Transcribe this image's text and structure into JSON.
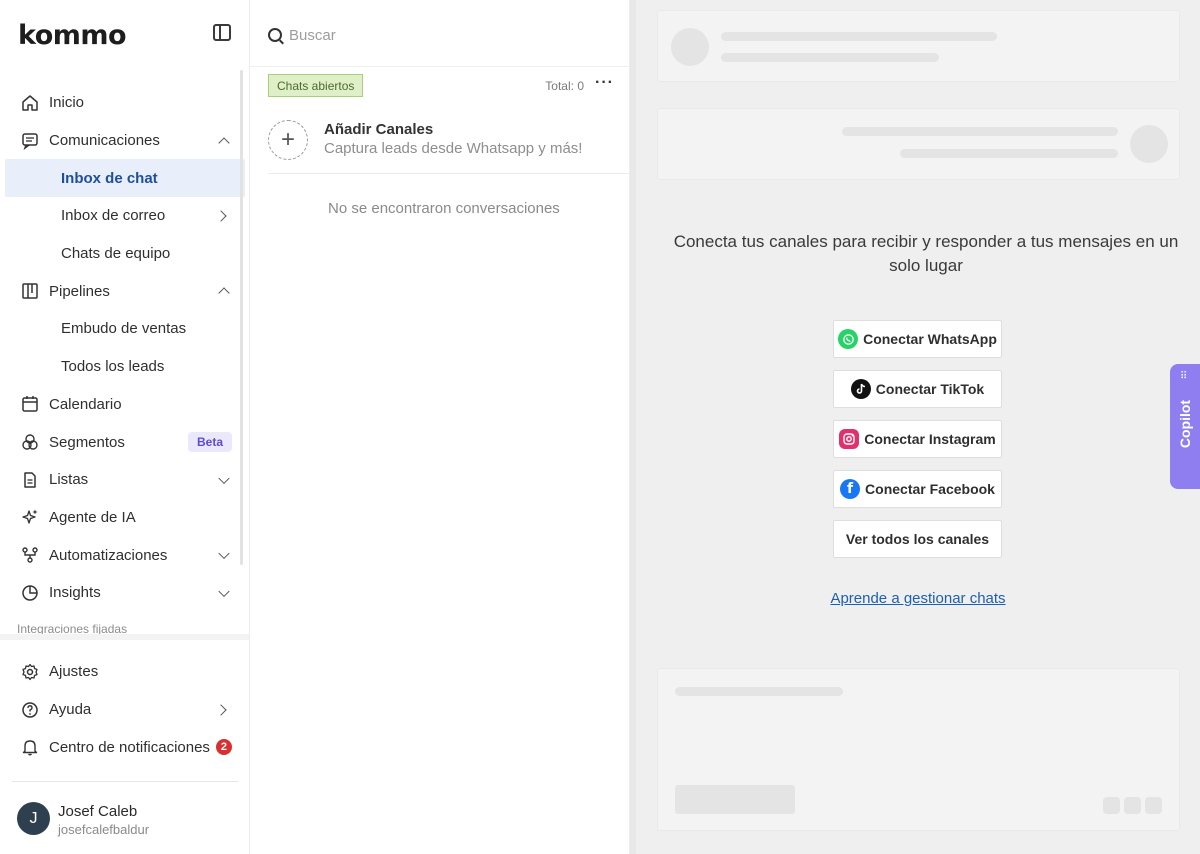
{
  "brand": {
    "logo_text": "kommo"
  },
  "sidebar": {
    "items": [
      {
        "label": "Inicio",
        "icon": "home-icon"
      },
      {
        "label": "Comunicaciones",
        "icon": "chat-bubble-icon",
        "expanded": true
      },
      {
        "label": "Inbox de chat",
        "sub": true,
        "active": true
      },
      {
        "label": "Inbox de correo",
        "sub": true
      },
      {
        "label": "Chats de equipo",
        "sub": true
      },
      {
        "label": "Pipelines",
        "icon": "pipeline-icon",
        "expanded": true
      },
      {
        "label": "Embudo de ventas",
        "sub": true
      },
      {
        "label": "Todos los leads",
        "sub": true
      },
      {
        "label": "Calendario",
        "icon": "calendar-icon"
      },
      {
        "label": "Segmentos",
        "icon": "segments-icon",
        "badge": "Beta"
      },
      {
        "label": "Listas",
        "icon": "list-icon"
      },
      {
        "label": "Agente de IA",
        "icon": "sparkle-icon"
      },
      {
        "label": "Automatizaciones",
        "icon": "automation-icon"
      },
      {
        "label": "Insights",
        "icon": "pie-chart-icon"
      }
    ],
    "pinned_label": "Integraciones fijadas",
    "bottom": {
      "settings": "Ajustes",
      "help": "Ayuda",
      "notifications": "Centro de notificaciones",
      "notifications_count": "2"
    },
    "user": {
      "initial": "J",
      "name": "Josef Caleb",
      "login": "josefcalefbaldur"
    }
  },
  "chatlist": {
    "search_placeholder": "Buscar",
    "filter": "Chats abiertos",
    "total": "Total: 0",
    "more": "···",
    "add_title": "Añadir Canales",
    "add_subtitle": "Captura leads desde Whatsapp y más!",
    "empty": "No se encontraron conversaciones"
  },
  "main": {
    "prompt": "Conecta tus canales para recibir y responder a tus mensajes en un solo lugar",
    "buttons": {
      "whatsapp": "Conectar WhatsApp",
      "tiktok": "Conectar TikTok",
      "instagram": "Conectar Instagram",
      "facebook": "Conectar Facebook",
      "all": "Ver todos los canales"
    },
    "learn_link": "Aprende a gestionar chats",
    "copilot": "Copilot"
  },
  "colors": {
    "accent": "#1f4f9a",
    "active_bg": "#e8effb",
    "whatsapp": "#25d366",
    "facebook": "#1877f2",
    "copilot": "#8f7ef0",
    "badge": "#d63031"
  }
}
